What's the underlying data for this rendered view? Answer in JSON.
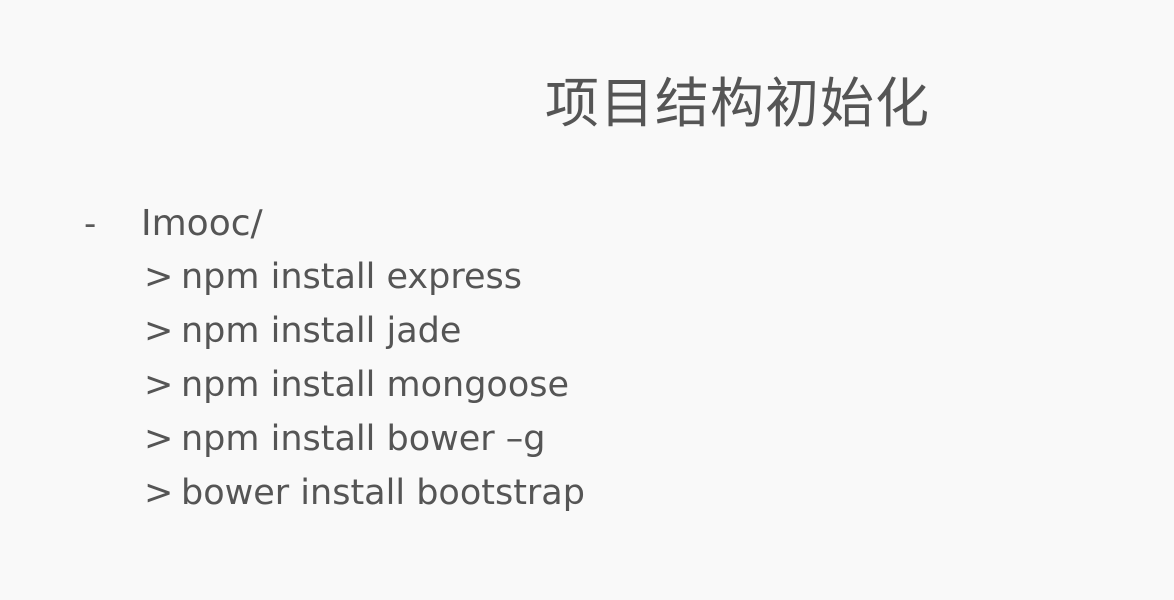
{
  "slide": {
    "title": "项目结构初始化",
    "bullet": "-",
    "folder": "Imooc/",
    "prompt_symbol": ">",
    "commands": [
      "npm install express",
      "npm install jade",
      "npm install mongoose",
      "npm install bower –g",
      "bower install bootstrap"
    ]
  },
  "colors": {
    "background": "#f9f9f9",
    "text": "#555555"
  }
}
